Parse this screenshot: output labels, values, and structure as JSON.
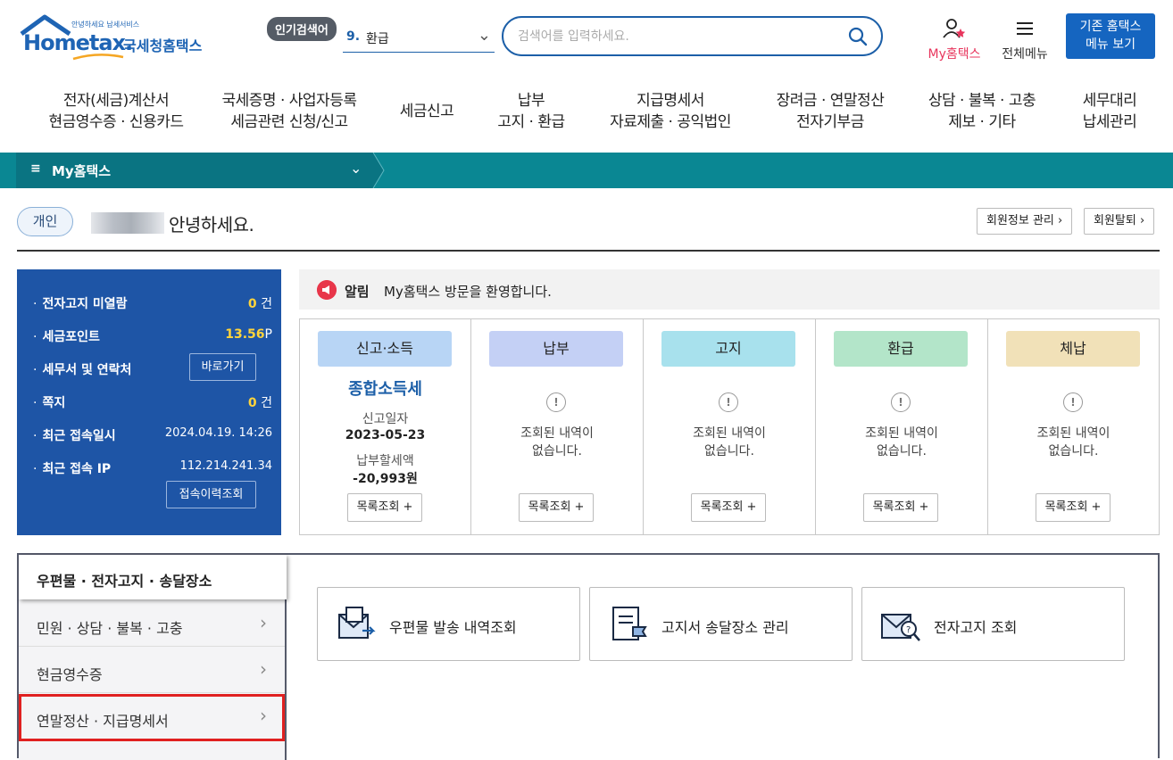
{
  "header": {
    "logo_small": "안녕하세요 납세서비스",
    "logo_brand": "Hometax.",
    "logo_kr": "국세청홈택스",
    "popular_tag": "인기검색어",
    "popular_num": "9.",
    "popular_term": "환급",
    "search_placeholder": "검색어를 입력하세요.",
    "myhometax_label": "My홈택스",
    "allmenu_label": "전체메뉴",
    "old_hometax_line1": "기존 홈택스",
    "old_hometax_line2": "메뉴 보기"
  },
  "gnb": [
    {
      "line1": "전자(세금)계산서",
      "line2": "현금영수증 · 신용카드"
    },
    {
      "line1": "국세증명 · 사업자등록",
      "line2": "세금관련 신청/신고"
    },
    {
      "line1": "세금신고",
      "line2": ""
    },
    {
      "line1": "납부",
      "line2": "고지 · 환급"
    },
    {
      "line1": "지급명세서",
      "line2": "자료제출 · 공익법인"
    },
    {
      "line1": "장려금 · 연말정산",
      "line2": "전자기부금"
    },
    {
      "line1": "상담 · 불복 · 고충",
      "line2": "제보 · 기타"
    },
    {
      "line1": "세무대리",
      "line2": "납세관리"
    }
  ],
  "bar": {
    "menu_icon": "≡",
    "title": "My홈택스"
  },
  "greeting": {
    "badge": "개인",
    "text": "안녕하세요.",
    "member_info_btn": "회원정보 관리 ›",
    "withdraw_btn": "회원탈퇴 ›"
  },
  "info": {
    "unread_label": "전자고지 미열람",
    "unread_val": "0",
    "unread_unit": "건",
    "points_label": "세금포인트",
    "points_val": "13.56",
    "points_unit": "P",
    "office_label": "세무서 및 연락처",
    "office_btn": "바로가기",
    "note_label": "쪽지",
    "note_val": "0",
    "note_unit": "건",
    "last_login_label": "최근 접속일시",
    "last_login_val": "2024.04.19.  14:26",
    "last_ip_label": "최근 접속 IP",
    "last_ip_val": "112.214.241.34",
    "history_btn": "접속이력조회"
  },
  "notice": {
    "label": "알림",
    "text": "My홈택스 방문을 환영합니다."
  },
  "cards": [
    {
      "title": "신고·소득",
      "color": "#b8d5f5",
      "tax_name": "종합소득세",
      "date_label": "신고일자",
      "date": "2023-05-23",
      "amount_label": "납부할세액",
      "amount": "-20,993원",
      "btn": "목록조회 +"
    },
    {
      "title": "납부",
      "color": "#c4d0f5",
      "empty": "조회된 내역이\n없습니다.",
      "btn": "목록조회 +"
    },
    {
      "title": "고지",
      "color": "#a8e1ed",
      "empty": "조회된 내역이\n없습니다.",
      "btn": "목록조회 +"
    },
    {
      "title": "환급",
      "color": "#b3e5c9",
      "empty": "조회된 내역이\n없습니다.",
      "btn": "목록조회 +"
    },
    {
      "title": "체납",
      "color": "#f1e1b8",
      "empty": "조회된 내역이\n없습니다.",
      "btn": "목록조회 +"
    }
  ],
  "bottom": {
    "title": "우편물 · 전자고지 · 송달장소",
    "left_menu": [
      "민원 · 상담 · 불복 · 고충",
      "현금영수증",
      "연말정산 · 지급명세서"
    ],
    "quick": [
      "우편물 발송 내역조회",
      "고지서 송달장소 관리",
      "전자고지 조회"
    ]
  },
  "colors": {
    "teal": "#0a8793",
    "blue": "#1e55a6",
    "brand": "#1e64b4",
    "highlight": "#e02020"
  }
}
